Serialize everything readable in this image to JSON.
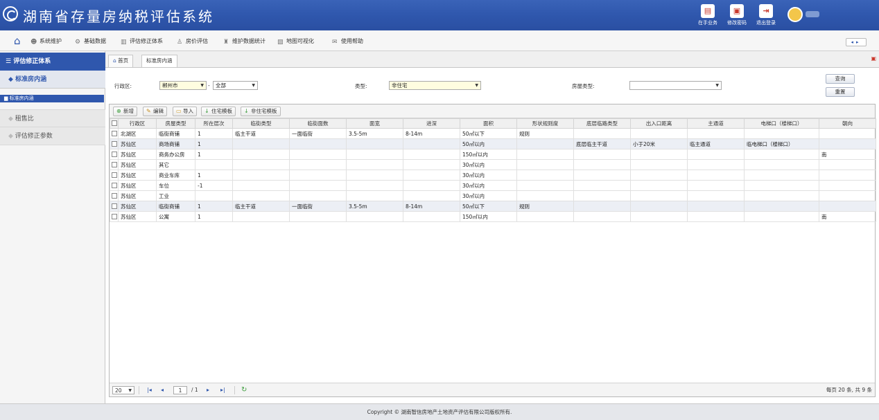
{
  "app": {
    "title": "湖南省存量房纳税评估系统",
    "actions": [
      {
        "label": "在手业务",
        "icon": "task-icon"
      },
      {
        "label": "修改密码",
        "icon": "lock-icon"
      },
      {
        "label": "退出登录",
        "icon": "logout-icon"
      }
    ]
  },
  "menu": {
    "items": [
      {
        "label": "系统维护",
        "icon": "users-icon"
      },
      {
        "label": "基础数据",
        "icon": "gear-icon"
      },
      {
        "label": "评估修正体系",
        "icon": "building-icon"
      },
      {
        "label": "房价评估",
        "icon": "user-icon"
      },
      {
        "label": "维护数据统计",
        "icon": "chart-icon"
      },
      {
        "label": "地图可视化",
        "icon": "map-icon"
      },
      {
        "label": "使用帮助",
        "icon": "help-icon"
      }
    ]
  },
  "sidebar": {
    "title": "评估修正体系",
    "active_group": "标准房内涵",
    "active_sub": "标准房内涵",
    "groups": [
      "租售比",
      "评估修正参数"
    ]
  },
  "tabs": [
    "首页",
    "标准房内涵"
  ],
  "form": {
    "district_label": "行政区:",
    "city_value": "郴州市",
    "area_value": "全部",
    "type_label": "类型:",
    "type_value": "非住宅",
    "house_type_label": "房屋类型:",
    "house_type_value": "",
    "query_button": "查询",
    "reset_button": "重置"
  },
  "toolbar": {
    "add": "新增",
    "edit": "编辑",
    "import": "导入",
    "residential_template": "住宅模板",
    "nonresidential_template": "非住宅模板"
  },
  "table": {
    "columns": [
      "行政区",
      "房屋类型",
      "所在层次",
      "临街类型",
      "临街面数",
      "面宽",
      "进深",
      "面积",
      "形状规则度",
      "底层临路类型",
      "出入口距离",
      "主通道",
      "电梯口（楼梯口）",
      "朝向"
    ],
    "rows": [
      [
        "北湖区",
        "临街商铺",
        "1",
        "临主干道",
        "一面临街",
        "3.5-5m",
        "8-14m",
        "50㎡以下",
        "规则",
        "",
        "",
        "",
        "",
        ""
      ],
      [
        "苏仙区",
        "商场商铺",
        "1",
        "",
        "",
        "",
        "",
        "50㎡以内",
        "",
        "底层临主干道",
        "小于20米",
        "临主通道",
        "临电梯口（楼梯口）",
        ""
      ],
      [
        "苏仙区",
        "商务办公房",
        "1",
        "",
        "",
        "",
        "",
        "150㎡以内",
        "",
        "",
        "",
        "",
        "",
        "南"
      ],
      [
        "苏仙区",
        "其它",
        "",
        "",
        "",
        "",
        "",
        "30㎡以内",
        "",
        "",
        "",
        "",
        "",
        ""
      ],
      [
        "苏仙区",
        "商业车库",
        "1",
        "",
        "",
        "",
        "",
        "30㎡以内",
        "",
        "",
        "",
        "",
        "",
        ""
      ],
      [
        "苏仙区",
        "车位",
        "-1",
        "",
        "",
        "",
        "",
        "30㎡以内",
        "",
        "",
        "",
        "",
        "",
        ""
      ],
      [
        "苏仙区",
        "工业",
        "",
        "",
        "",
        "",
        "",
        "30㎡以内",
        "",
        "",
        "",
        "",
        "",
        ""
      ],
      [
        "苏仙区",
        "临街商铺",
        "1",
        "临主干道",
        "一面临街",
        "3.5-5m",
        "8-14m",
        "50㎡以下",
        "规则",
        "",
        "",
        "",
        "",
        ""
      ],
      [
        "苏仙区",
        "公寓",
        "1",
        "",
        "",
        "",
        "",
        "150㎡以内",
        "",
        "",
        "",
        "",
        "",
        "南"
      ]
    ]
  },
  "pager": {
    "page_size": "20",
    "current_page": "1",
    "total_pages": "/ 1",
    "summary": "每页 20 条, 共 9 条"
  },
  "footer": "Copyright © 湖南智信房地产土地资产评估有限公司版权所有."
}
